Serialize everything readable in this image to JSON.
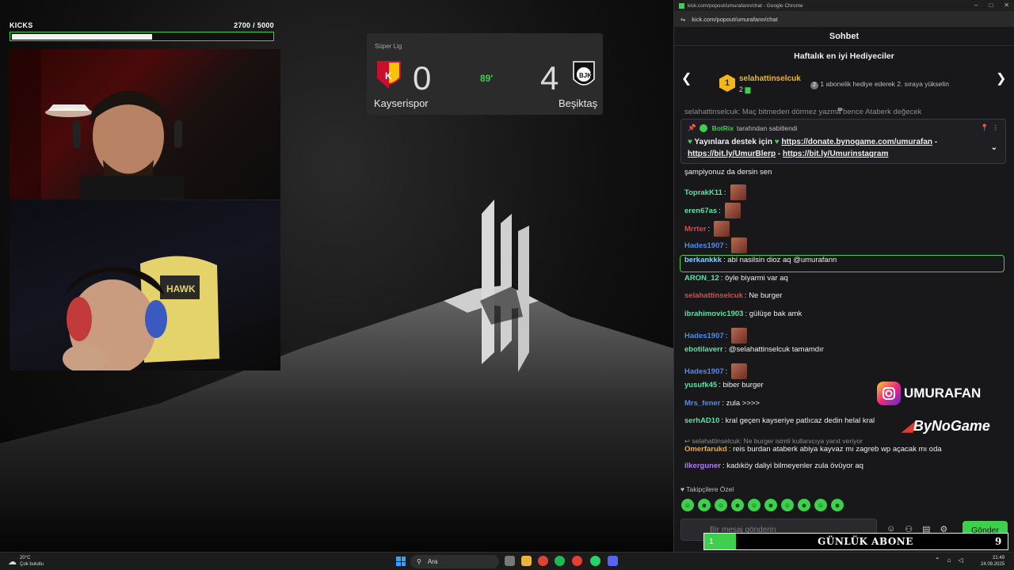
{
  "kicks": {
    "label": "KICKS",
    "progress_text": "2700   / 5000",
    "current": 2700,
    "goal": 5000,
    "fill_pct": 54
  },
  "scoreboard": {
    "league": "Süper Lig",
    "home_team": "Kayserispor",
    "home_score": "0",
    "away_team": "Beşiktaş",
    "away_score": "4",
    "minute": "89'"
  },
  "browser": {
    "window_title": "kick.com/popout/umurafann/chat - Google Chrome",
    "url": "kick.com/popout/umurafann/chat"
  },
  "chat": {
    "title": "Sohbet",
    "gifters_title": "Haftalık en iyi Hediyeciler",
    "top_gifter": {
      "rank": "1",
      "name": "selahattinselcuk",
      "count": "2"
    },
    "next_hint_rank": "2",
    "next_hint": "1 abonelik hediye ederek 2. sıraya yükselin",
    "partial_top": "selahattinselcuk: Maç bitmeden dörmez yazma bence Ataberk değecek",
    "pinned": {
      "bot": "BotRix",
      "suffix": "tarafından sabitlendi",
      "line1_text": "Yayınlara destek için",
      "link1": "https://donate.bynogame.com/umurafan",
      "link2": "https://bit.ly/UmurBlerp",
      "link3": "https://bit.ly/Umurinstagram",
      "sep1": " -",
      "sep2": " - "
    },
    "messages": [
      {
        "user": "",
        "text": "şampiyonuz da dersin sen",
        "color": "#efeff1",
        "emote": false
      },
      {
        "user": "ToprakK11",
        "text": ":",
        "color": "#5ee0a6",
        "emote": true
      },
      {
        "user": "eren67as",
        "text": ":",
        "color": "#5ee0a6",
        "emote": true
      },
      {
        "user": "Mrrter",
        "text": ":",
        "color": "#e04848",
        "emote": true
      },
      {
        "user": "Hades1907",
        "text": ":",
        "color": "#4a8df0",
        "emote": true
      },
      {
        "user": "berkankkk",
        "text": ": abi nasilsin dioz aq @umurafann",
        "color": "#8ad0ff",
        "emote": false
      },
      {
        "user": "ARON_12",
        "text": ": öyle biyarmi var aq",
        "color": "#5ee0a6",
        "emote": false
      },
      {
        "user": "selahattinselcuk",
        "text": ": Ne burger",
        "color": "#e04848",
        "emote": false
      },
      {
        "user": "ibrahimovic1903",
        "text": ": gülüşe bak amk",
        "color": "#5ee0a6",
        "emote": false
      },
      {
        "user": "Hades1907",
        "text": ":",
        "color": "#4a8df0",
        "emote": true
      },
      {
        "user": "ebotilaverr",
        "text": ": @selahattinselcuk tamamdır",
        "color": "#5ee0a6",
        "emote": false
      },
      {
        "user": "Hades1907",
        "text": ":",
        "color": "#4a8df0",
        "emote": true
      },
      {
        "user": "yusufk45",
        "text": ": biber burger",
        "color": "#5ee0a6",
        "emote": false
      },
      {
        "user": "Mrs_fener",
        "text": ": zula >>>>",
        "color": "#4a8df0",
        "emote": false
      },
      {
        "user": "serhAD10",
        "text": ": kral geçen kayseriye patlıcaz dedin helal kral",
        "color": "#5ee0a6",
        "emote": false
      },
      {
        "user": "Omerfarukd",
        "text": ": reis burdan ataberk abiya kayvaz mı zagreb wp açacak mı oda",
        "color": "#f3a43a",
        "emote": false
      },
      {
        "user": "ilkerguner",
        "text": ": kadıköy daliyi bilmeyenler zula övüyor aq",
        "color": "#b07af0",
        "emote": false
      }
    ],
    "reply_ref": "selahattinselcuk: Ne burger isimli kullanıcıya yanıt veriyor",
    "followers_label": "Takipçilere Özel",
    "input_placeholder": "Bir mesaj gönderin",
    "send_label": "Gönder"
  },
  "overlay": {
    "instagram": "UMURAFAN",
    "bynogame_prefix": "By",
    "bynogame_rest": "NoGame"
  },
  "daily_sub": {
    "label": "GÜNLÜK ABONE",
    "current": "1",
    "goal": "9",
    "fill_fraction": 0.11
  },
  "taskbar": {
    "weather_temp": "20°C",
    "weather_desc": "Çok bulutlu",
    "search_label": "Ara",
    "time": "21:49",
    "date": "24.09.2025"
  }
}
